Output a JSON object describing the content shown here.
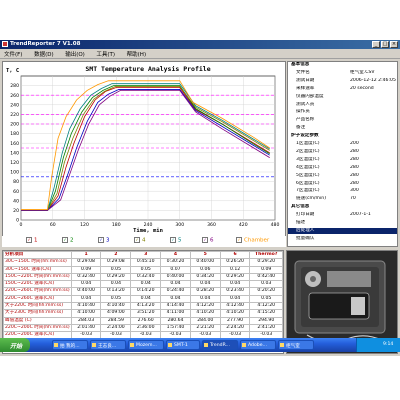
{
  "window": {
    "title": "TrendReporter 7 V1.08"
  },
  "menu": [
    "文件(F)",
    "数据(D)",
    "输出(O)",
    "工具(T)",
    "帮助(H)"
  ],
  "chart_data": {
    "type": "line",
    "title": "SMT Temperature Analysis Profile",
    "xlabel": "Time, min",
    "ylabel": "T, C",
    "xlim": [
      0,
      480
    ],
    "ylim": [
      0,
      300
    ],
    "xticks": [
      0,
      60,
      120,
      180,
      240,
      300,
      360,
      420,
      480
    ],
    "yticks": [
      0,
      20,
      40,
      60,
      80,
      100,
      120,
      140,
      160,
      180,
      200,
      220,
      240,
      260,
      280
    ],
    "grid": true,
    "series": [
      {
        "name": "1",
        "color": "#c00000",
        "x": [
          0,
          50,
          70,
          85,
          100,
          120,
          140,
          160,
          180,
          260,
          300,
          330,
          380,
          440,
          470
        ],
        "y": [
          20,
          20,
          50,
          110,
          160,
          215,
          250,
          268,
          276,
          276,
          276,
          230,
          200,
          160,
          140
        ]
      },
      {
        "name": "2",
        "color": "#008000",
        "x": [
          0,
          50,
          65,
          80,
          95,
          115,
          135,
          155,
          175,
          260,
          300,
          330,
          380,
          440,
          470
        ],
        "y": [
          20,
          20,
          60,
          130,
          180,
          225,
          255,
          270,
          280,
          280,
          280,
          232,
          200,
          158,
          138
        ]
      },
      {
        "name": "3",
        "color": "#0000c0",
        "x": [
          0,
          50,
          72,
          90,
          105,
          125,
          145,
          165,
          185,
          260,
          300,
          330,
          380,
          440,
          470
        ],
        "y": [
          20,
          20,
          45,
          100,
          150,
          205,
          245,
          262,
          272,
          272,
          272,
          228,
          195,
          155,
          135
        ]
      },
      {
        "name": "4",
        "color": "#808000",
        "x": [
          0,
          50,
          68,
          82,
          98,
          118,
          138,
          158,
          178,
          260,
          300,
          330,
          380,
          440,
          470
        ],
        "y": [
          20,
          20,
          55,
          120,
          170,
          220,
          252,
          268,
          278,
          278,
          278,
          235,
          205,
          165,
          145
        ]
      },
      {
        "name": "5",
        "color": "#008080",
        "x": [
          0,
          50,
          62,
          78,
          92,
          112,
          132,
          152,
          172,
          260,
          300,
          330,
          380,
          440,
          470
        ],
        "y": [
          20,
          20,
          65,
          140,
          190,
          232,
          260,
          274,
          284,
          284,
          284,
          238,
          208,
          168,
          148
        ]
      },
      {
        "name": "6",
        "color": "#800080",
        "x": [
          0,
          50,
          75,
          92,
          108,
          128,
          148,
          168,
          188,
          260,
          300,
          330,
          380,
          440,
          470
        ],
        "y": [
          20,
          20,
          42,
          95,
          145,
          200,
          240,
          258,
          270,
          270,
          270,
          225,
          190,
          150,
          130
        ]
      },
      {
        "name": "Chamber",
        "color": "#ff9900",
        "x": [
          0,
          50,
          58,
          70,
          85,
          105,
          125,
          145,
          165,
          260,
          300,
          325,
          380,
          440,
          470
        ],
        "y": [
          22,
          22,
          90,
          170,
          215,
          250,
          270,
          282,
          290,
          290,
          290,
          245,
          212,
          172,
          150
        ]
      }
    ],
    "hlines": [
      {
        "y": 260,
        "color": "#ff00ff"
      },
      {
        "y": 220,
        "color": "#ff00ff"
      },
      {
        "y": 200,
        "color": "#ff00ff"
      },
      {
        "y": 150,
        "color": "#ff00ff"
      },
      {
        "y": 90,
        "color": "#0000ff"
      }
    ]
  },
  "legend": [
    {
      "label": "1",
      "checked": true
    },
    {
      "label": "2",
      "checked": true
    },
    {
      "label": "3",
      "checked": true
    },
    {
      "label": "4",
      "checked": true
    },
    {
      "label": "5",
      "checked": true
    },
    {
      "label": "6",
      "checked": true
    },
    {
      "label": "Chamber",
      "checked": true
    }
  ],
  "props": [
    {
      "k": "基本信息",
      "v": "",
      "sec": true
    },
    {
      "k": "文件名",
      "v": "柜气室.CSV"
    },
    {
      "k": "测试日期",
      "v": "2006-12-12 2:46:05 PM"
    },
    {
      "k": "采样速率",
      "v": "20 second"
    },
    {
      "k": "仪器内部温度",
      "v": ""
    },
    {
      "k": "测试人员",
      "v": ""
    },
    {
      "k": "操作员",
      "v": ""
    },
    {
      "k": "产品名称",
      "v": ""
    },
    {
      "k": "备注",
      "v": ""
    },
    {
      "k": "炉子设定参数",
      "v": "",
      "sec": true
    },
    {
      "k": "1区温度(C)",
      "v": "200"
    },
    {
      "k": "2区温度(C)",
      "v": "280"
    },
    {
      "k": "3区温度(C)",
      "v": "280"
    },
    {
      "k": "4区温度(C)",
      "v": "280"
    },
    {
      "k": "5区温度(C)",
      "v": "280"
    },
    {
      "k": "6区温度(C)",
      "v": "280"
    },
    {
      "k": "7区温度(C)",
      "v": "300"
    },
    {
      "k": "链速(cm/min)",
      "v": "70"
    },
    {
      "k": "其它信息",
      "v": "",
      "sec": true
    },
    {
      "k": "打印日期",
      "v": "2007-1-1"
    },
    {
      "k": "描述",
      "v": ""
    },
    {
      "k": "后处理人",
      "v": "",
      "sel": true
    },
    {
      "k": "批量确认",
      "v": ""
    }
  ],
  "table": {
    "header": [
      "分析项目",
      "1",
      "2",
      "3",
      "4",
      "5",
      "6",
      "Thermo?"
    ],
    "rows": [
      [
        "30C~150C 时间(hh:mm:ss)",
        "0:29:08",
        "0:29:08",
        "0:45:10",
        "0:30:20",
        "0:40:00",
        "0:26:20",
        "0:29:20"
      ],
      [
        "30C~150C 速率(C/s)",
        "0.09",
        "0.05",
        "0.05",
        "0.07",
        "0.06",
        "0.12",
        "0.09"
      ],
      [
        "150C~220C 时间(hh:mm:ss)",
        "0:32:40",
        "0:29:20",
        "0:32:40",
        "0:40:00",
        "0:34:20",
        "0:29:20",
        "0:42:40"
      ],
      [
        "150C~220C 速率(C/s)",
        "0.04",
        "0.04",
        "0.04",
        "0.04",
        "0.04",
        "0.04",
        "0.03"
      ],
      [
        "220C~260C 时间(hh:mm:ss)",
        "0:40:00",
        "0:13:20",
        "0:14:20",
        "0:24:40",
        "0:28:20",
        "0:23:40",
        "0:20:20"
      ],
      [
        "220C~260C 速率(C/s)",
        "0.04",
        "0.05",
        "0.04",
        "0.04",
        "0.04",
        "0.04",
        "0.05"
      ],
      [
        "大于220C 时间(hh:mm:ss)",
        "4:10:40",
        "4:10:40",
        "4:13:20",
        "4:14:40",
        "4:12:20",
        "4:12:40",
        "4:12:20"
      ],
      [
        "大于230C 时间(hh:mm:ss)",
        "4:10:00",
        "4:09:00",
        "3:51:20",
        "4:11:00",
        "4:10:20",
        "4:10:20",
        "4:15:20"
      ],
      [
        "峰值温度 (C)",
        "284.03",
        "284.59",
        "276.60",
        "280.64",
        "284.00",
        "277.90",
        "294.90"
      ],
      [
        "220C~200C 时间(hh:mm:ss)",
        "2:01:40",
        "2:24:00",
        "2:36:00",
        "1:57:40",
        "2:21:20",
        "2:24:20",
        "2:41:20"
      ],
      [
        "220C~200C 速率(C/s)",
        "-0.03",
        "-0.03",
        "-0.03",
        "-0.03",
        "-0.03",
        "-0.03",
        "-0.03"
      ]
    ]
  },
  "taskbar": {
    "start": "开始",
    "items": [
      "拍 我的...",
      "王志良...",
      "Mozem...",
      "SMT-1",
      "TrendR...",
      "Adobe...",
      "柜气室"
    ],
    "clock": "9:14"
  }
}
